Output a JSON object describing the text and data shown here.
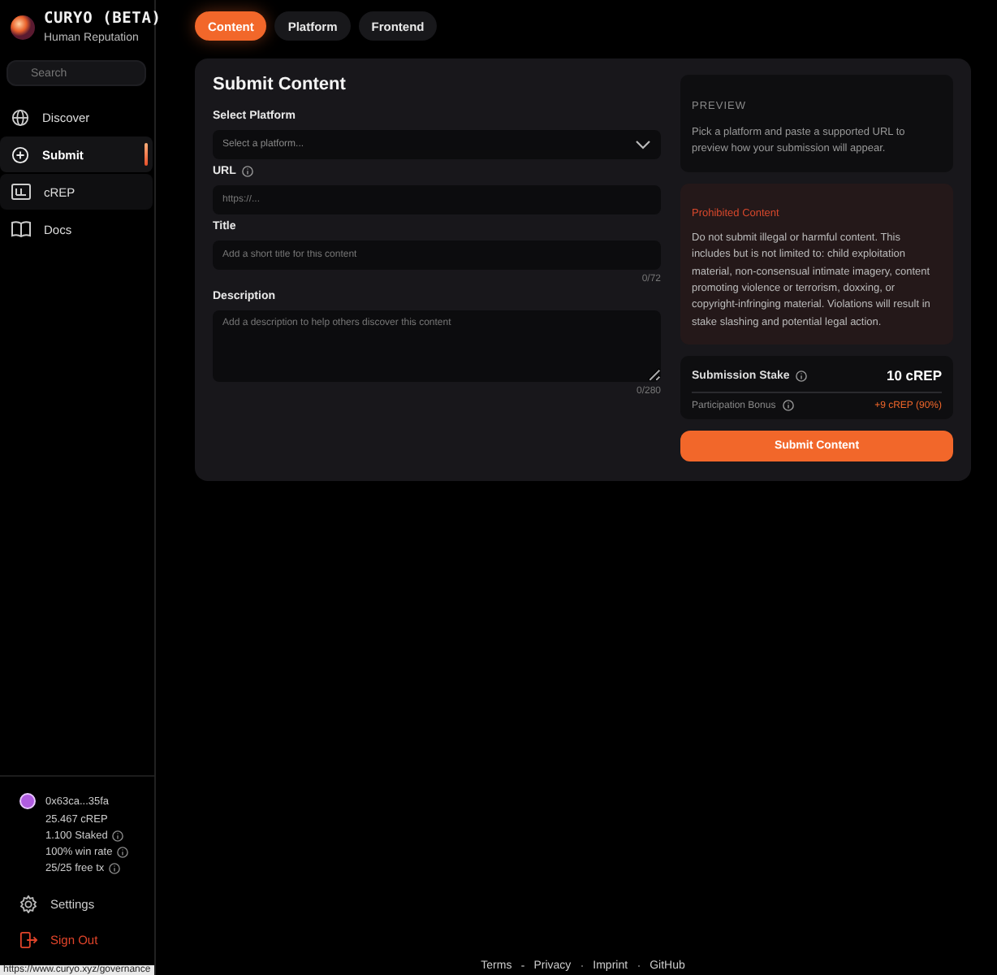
{
  "brand": {
    "name": "CURYO (BETA)",
    "tagline": "Human Reputation"
  },
  "sidebar": {
    "search": {
      "placeholder": "Search"
    },
    "items": [
      {
        "label": "Discover",
        "selected": false,
        "hovered": false
      },
      {
        "label": "Submit",
        "selected": true,
        "hovered": false
      },
      {
        "label": "cREP",
        "selected": false,
        "hovered": true
      },
      {
        "label": "Docs",
        "selected": false,
        "hovered": false
      }
    ],
    "wallet": {
      "address": "0x63ca...35fa",
      "balance": "25.467 cREP",
      "stats": [
        "1.100 Staked",
        "100% win rate",
        "25/25 free tx"
      ]
    },
    "bottom_items": [
      {
        "label": "Settings",
        "kind": "settings"
      },
      {
        "label": "Sign Out",
        "kind": "signout"
      }
    ]
  },
  "tabs": [
    {
      "label": "Content",
      "selected": true
    },
    {
      "label": "Platform",
      "selected": false
    },
    {
      "label": "Frontend",
      "selected": false
    }
  ],
  "form": {
    "title": "Submit Content",
    "fields": [
      {
        "kind": "select",
        "label": "Select Platform",
        "placeholder": "Select a platform..."
      },
      {
        "kind": "input",
        "label": "URL",
        "info": true,
        "placeholder": "https://..."
      },
      {
        "kind": "input",
        "label": "Title",
        "placeholder": "Add a short title for this content",
        "counter": "0/72"
      },
      {
        "kind": "textarea",
        "label": "Description",
        "placeholder": "Add a description to help others discover this content",
        "counter": "0/280"
      }
    ]
  },
  "preview": {
    "heading": "PREVIEW",
    "text": "Pick a platform and paste a supported URL to preview how your submission will appear."
  },
  "warning": {
    "heading": "Prohibited Content",
    "text": "Do not submit illegal or harmful content. This includes but is not limited to: child exploitation material, non-consensual intimate imagery, content promoting violence or terrorism, doxxing, or copyright-infringing material. Violations will result in stake slashing and potential legal action."
  },
  "stake": {
    "label": "Submission Stake",
    "value": "10 cREP",
    "bonus_label": "Participation Bonus",
    "bonus_value": "+9 cREP (90%)"
  },
  "submit_button": "Submit Content",
  "footer_links": [
    "Terms",
    "Privacy",
    "Imprint",
    "GitHub"
  ],
  "status_url": "https://www.curyo.xyz/governance"
}
